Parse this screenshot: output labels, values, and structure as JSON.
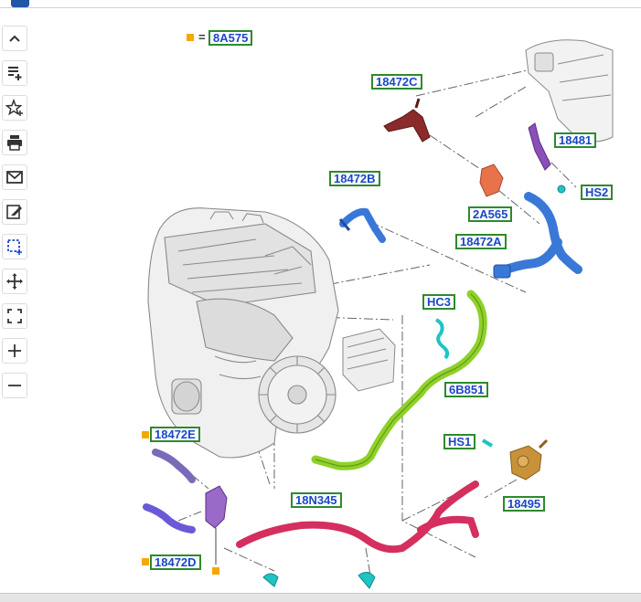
{
  "legend": {
    "equals": "=",
    "label": "8A575"
  },
  "labels": {
    "l18472C": "18472C",
    "l18481": "18481",
    "l18472B": "18472B",
    "lHS2": "HS2",
    "l2A565": "2A565",
    "l18472A": "18472A",
    "lHC3": "HC3",
    "l6B851": "6B851",
    "l18472E": "18472E",
    "lHS1": "HS1",
    "l18N345": "18N345",
    "l18495": "18495",
    "l18472D": "18472D"
  },
  "toolbar": [
    {
      "id": "scroll-up",
      "icon": "chevron-up-icon"
    },
    {
      "id": "add-note",
      "icon": "note-add-icon"
    },
    {
      "id": "favorite",
      "icon": "star-add-icon"
    },
    {
      "id": "print",
      "icon": "printer-icon"
    },
    {
      "id": "email",
      "icon": "mail-icon"
    },
    {
      "id": "annotate",
      "icon": "edit-note-icon"
    },
    {
      "id": "select-area",
      "icon": "select-area-icon"
    },
    {
      "id": "pan",
      "icon": "move-icon"
    },
    {
      "id": "fit",
      "icon": "fit-screen-icon"
    },
    {
      "id": "zoom-in",
      "icon": "plus-icon"
    },
    {
      "id": "zoom-out",
      "icon": "minus-icon"
    }
  ],
  "colors": {
    "label_border": "#2d8a2d",
    "label_text": "#1a47c8",
    "marker": "#f5a800",
    "hose_dark_red": "#8b2a2a",
    "hose_blue": "#3a78d8",
    "hose_green": "#8fd12a",
    "hose_pink": "#d42f5e",
    "hose_purple": "#7a6ab8",
    "clip_cyan": "#1fc4c4",
    "valve_orange": "#c8923a",
    "engine_gray": "#c9c9c9"
  }
}
